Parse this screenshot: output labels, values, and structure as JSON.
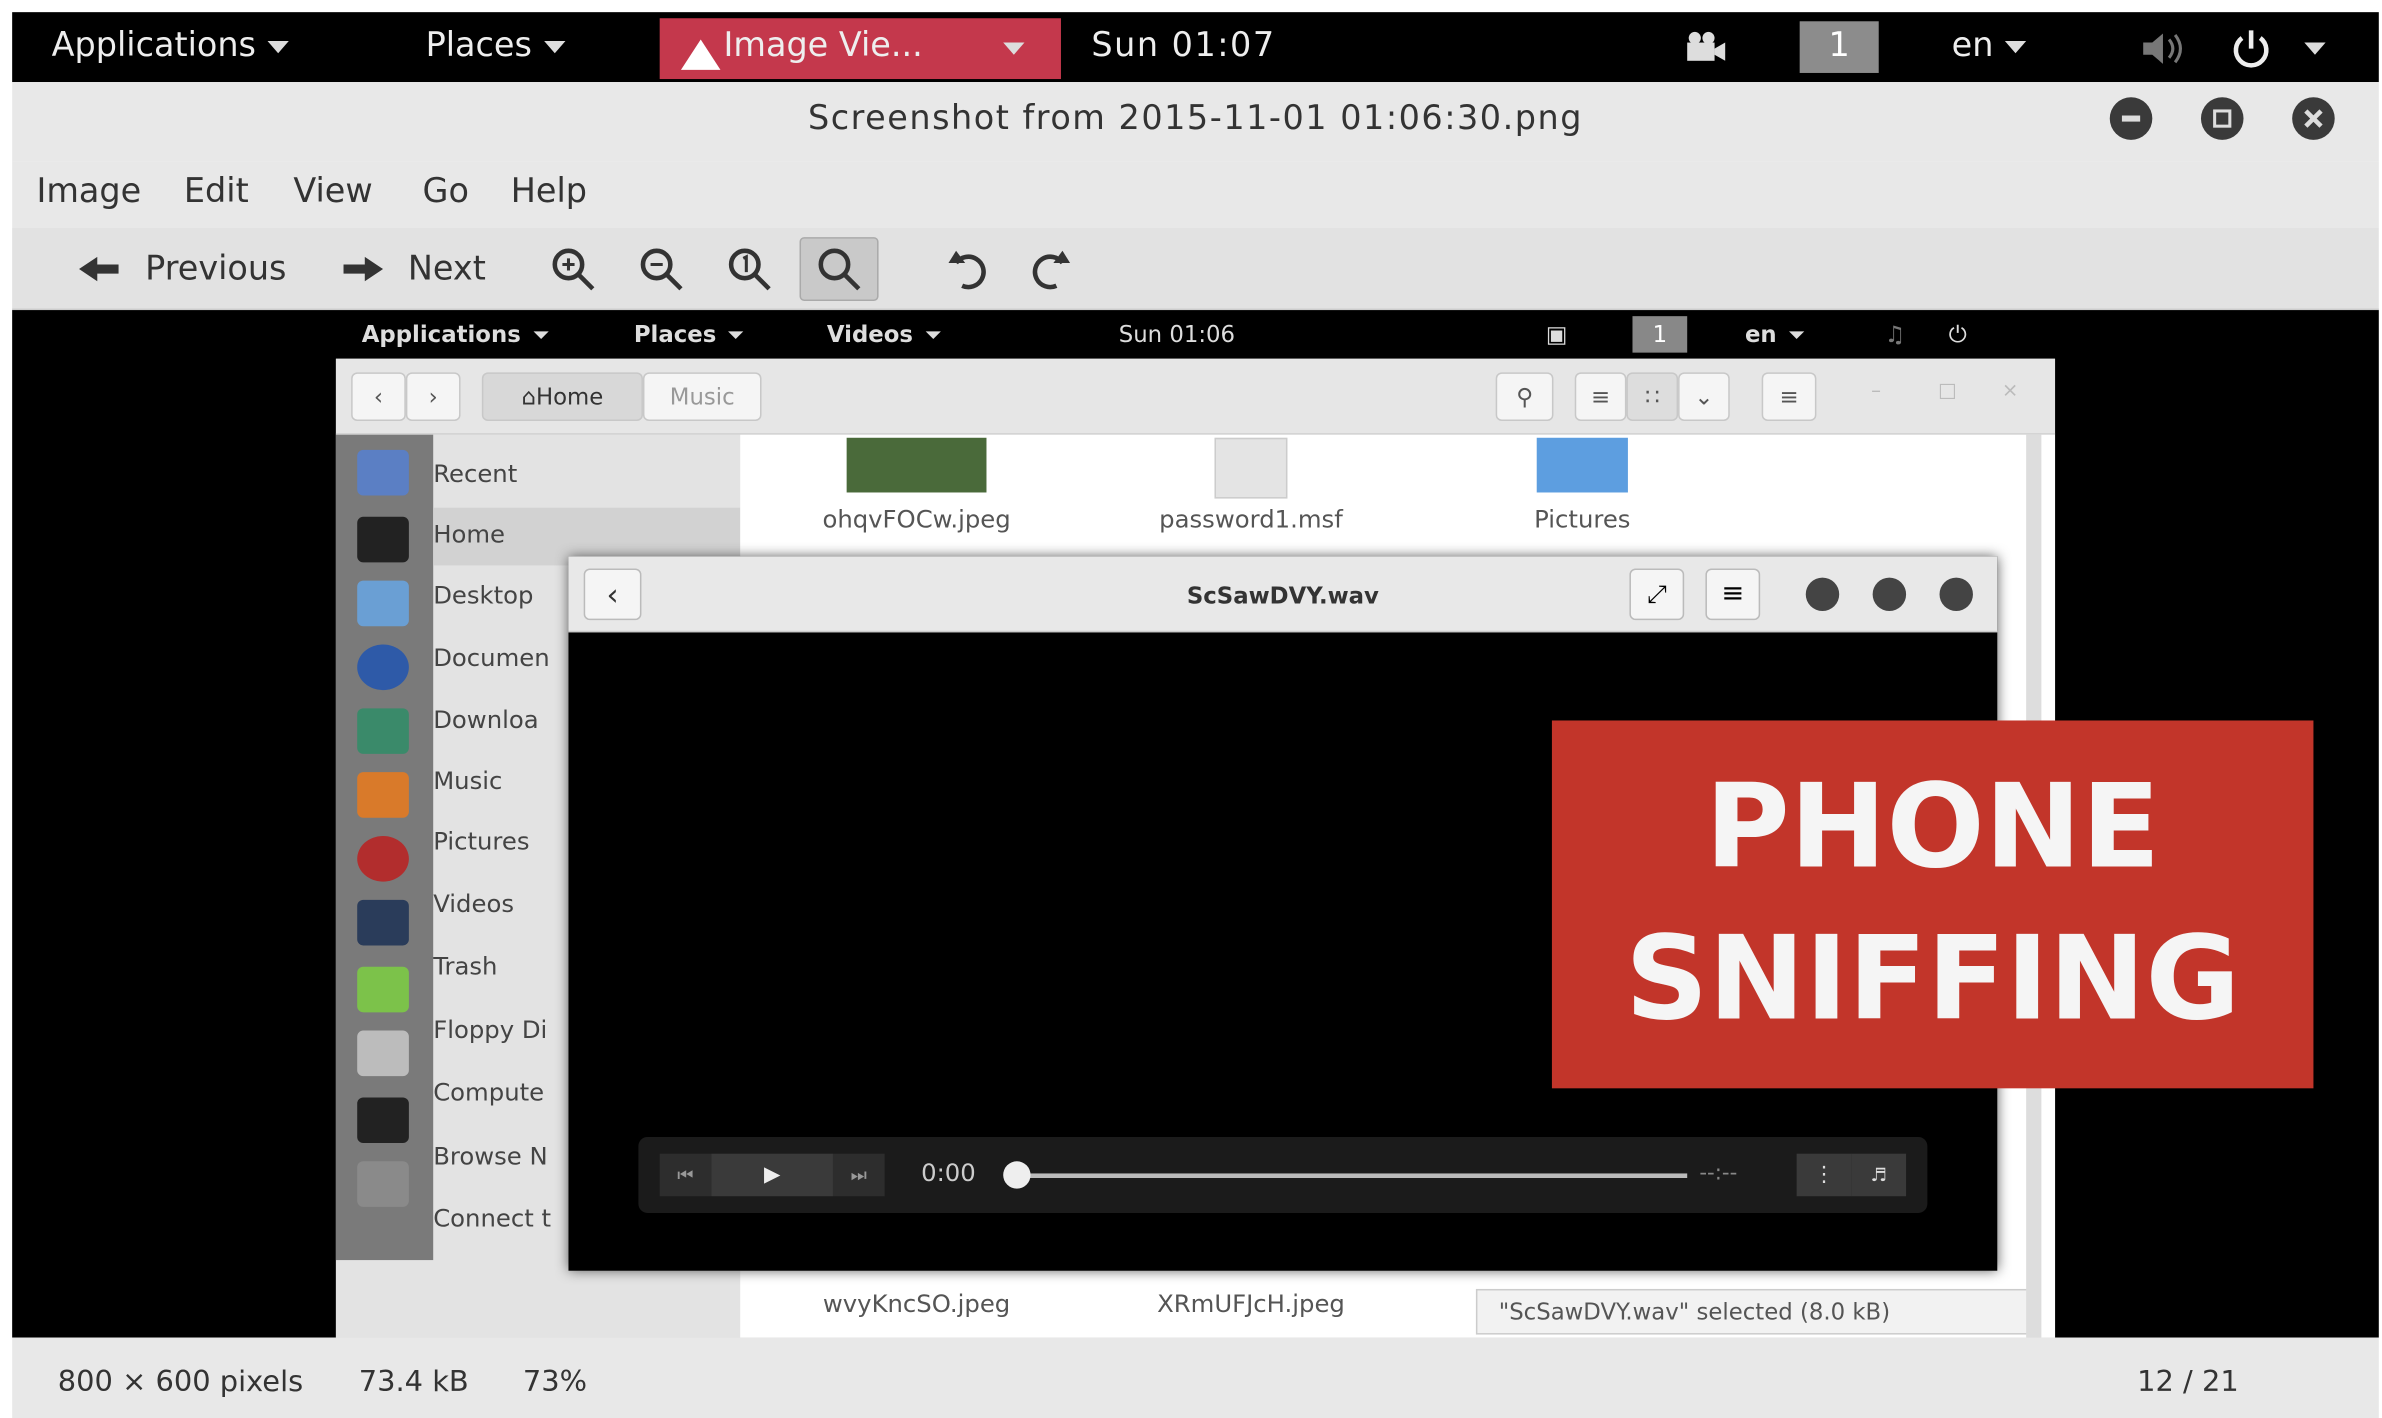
{
  "topbar": {
    "applications": "Applications",
    "places": "Places",
    "active_app": "Image Vie...",
    "clock": "Sun 01:07",
    "workspace": "1",
    "language": "en"
  },
  "window": {
    "title": "Screenshot from 2015-11-01 01:06:30.png"
  },
  "menu": [
    "Image",
    "Edit",
    "View",
    "Go",
    "Help"
  ],
  "toolbar": {
    "previous": "Previous",
    "next": "Next"
  },
  "status": {
    "dimensions": "800 × 600 pixels",
    "size": "73.4 kB",
    "zoom": "73%",
    "position": "12 / 21"
  },
  "inner_topbar": {
    "applications": "Applications",
    "places": "Places",
    "active_app": "Videos",
    "clock": "Sun 01:06",
    "workspace": "1",
    "language": "en"
  },
  "file_manager": {
    "breadcrumb": [
      "Home",
      "Music"
    ],
    "sidebar": [
      "Recent",
      "Home",
      "Desktop",
      "Documen",
      "Downloa",
      "Music",
      "Pictures",
      "Videos",
      "Trash",
      "Floppy Di",
      "Compute",
      "Browse N",
      "Connect t"
    ],
    "files_top": [
      "ohqvFOCw.jpeg",
      "password1.msf",
      "Pictures"
    ],
    "files_bottom": [
      "wvyKncSO.jpeg",
      "XRmUFJcH.jpeg"
    ],
    "selection_status": "\"ScSawDVY.wav\" selected (8.0 kB)"
  },
  "player": {
    "title": "ScSawDVY.wav",
    "time": "0:00",
    "remaining": "--:--",
    "progress": 0
  },
  "overlay": {
    "line1": "PHONE",
    "line2": "SNIFFING"
  },
  "colors": {
    "banner": "#c2352a",
    "active_tab": "#c4384c"
  }
}
